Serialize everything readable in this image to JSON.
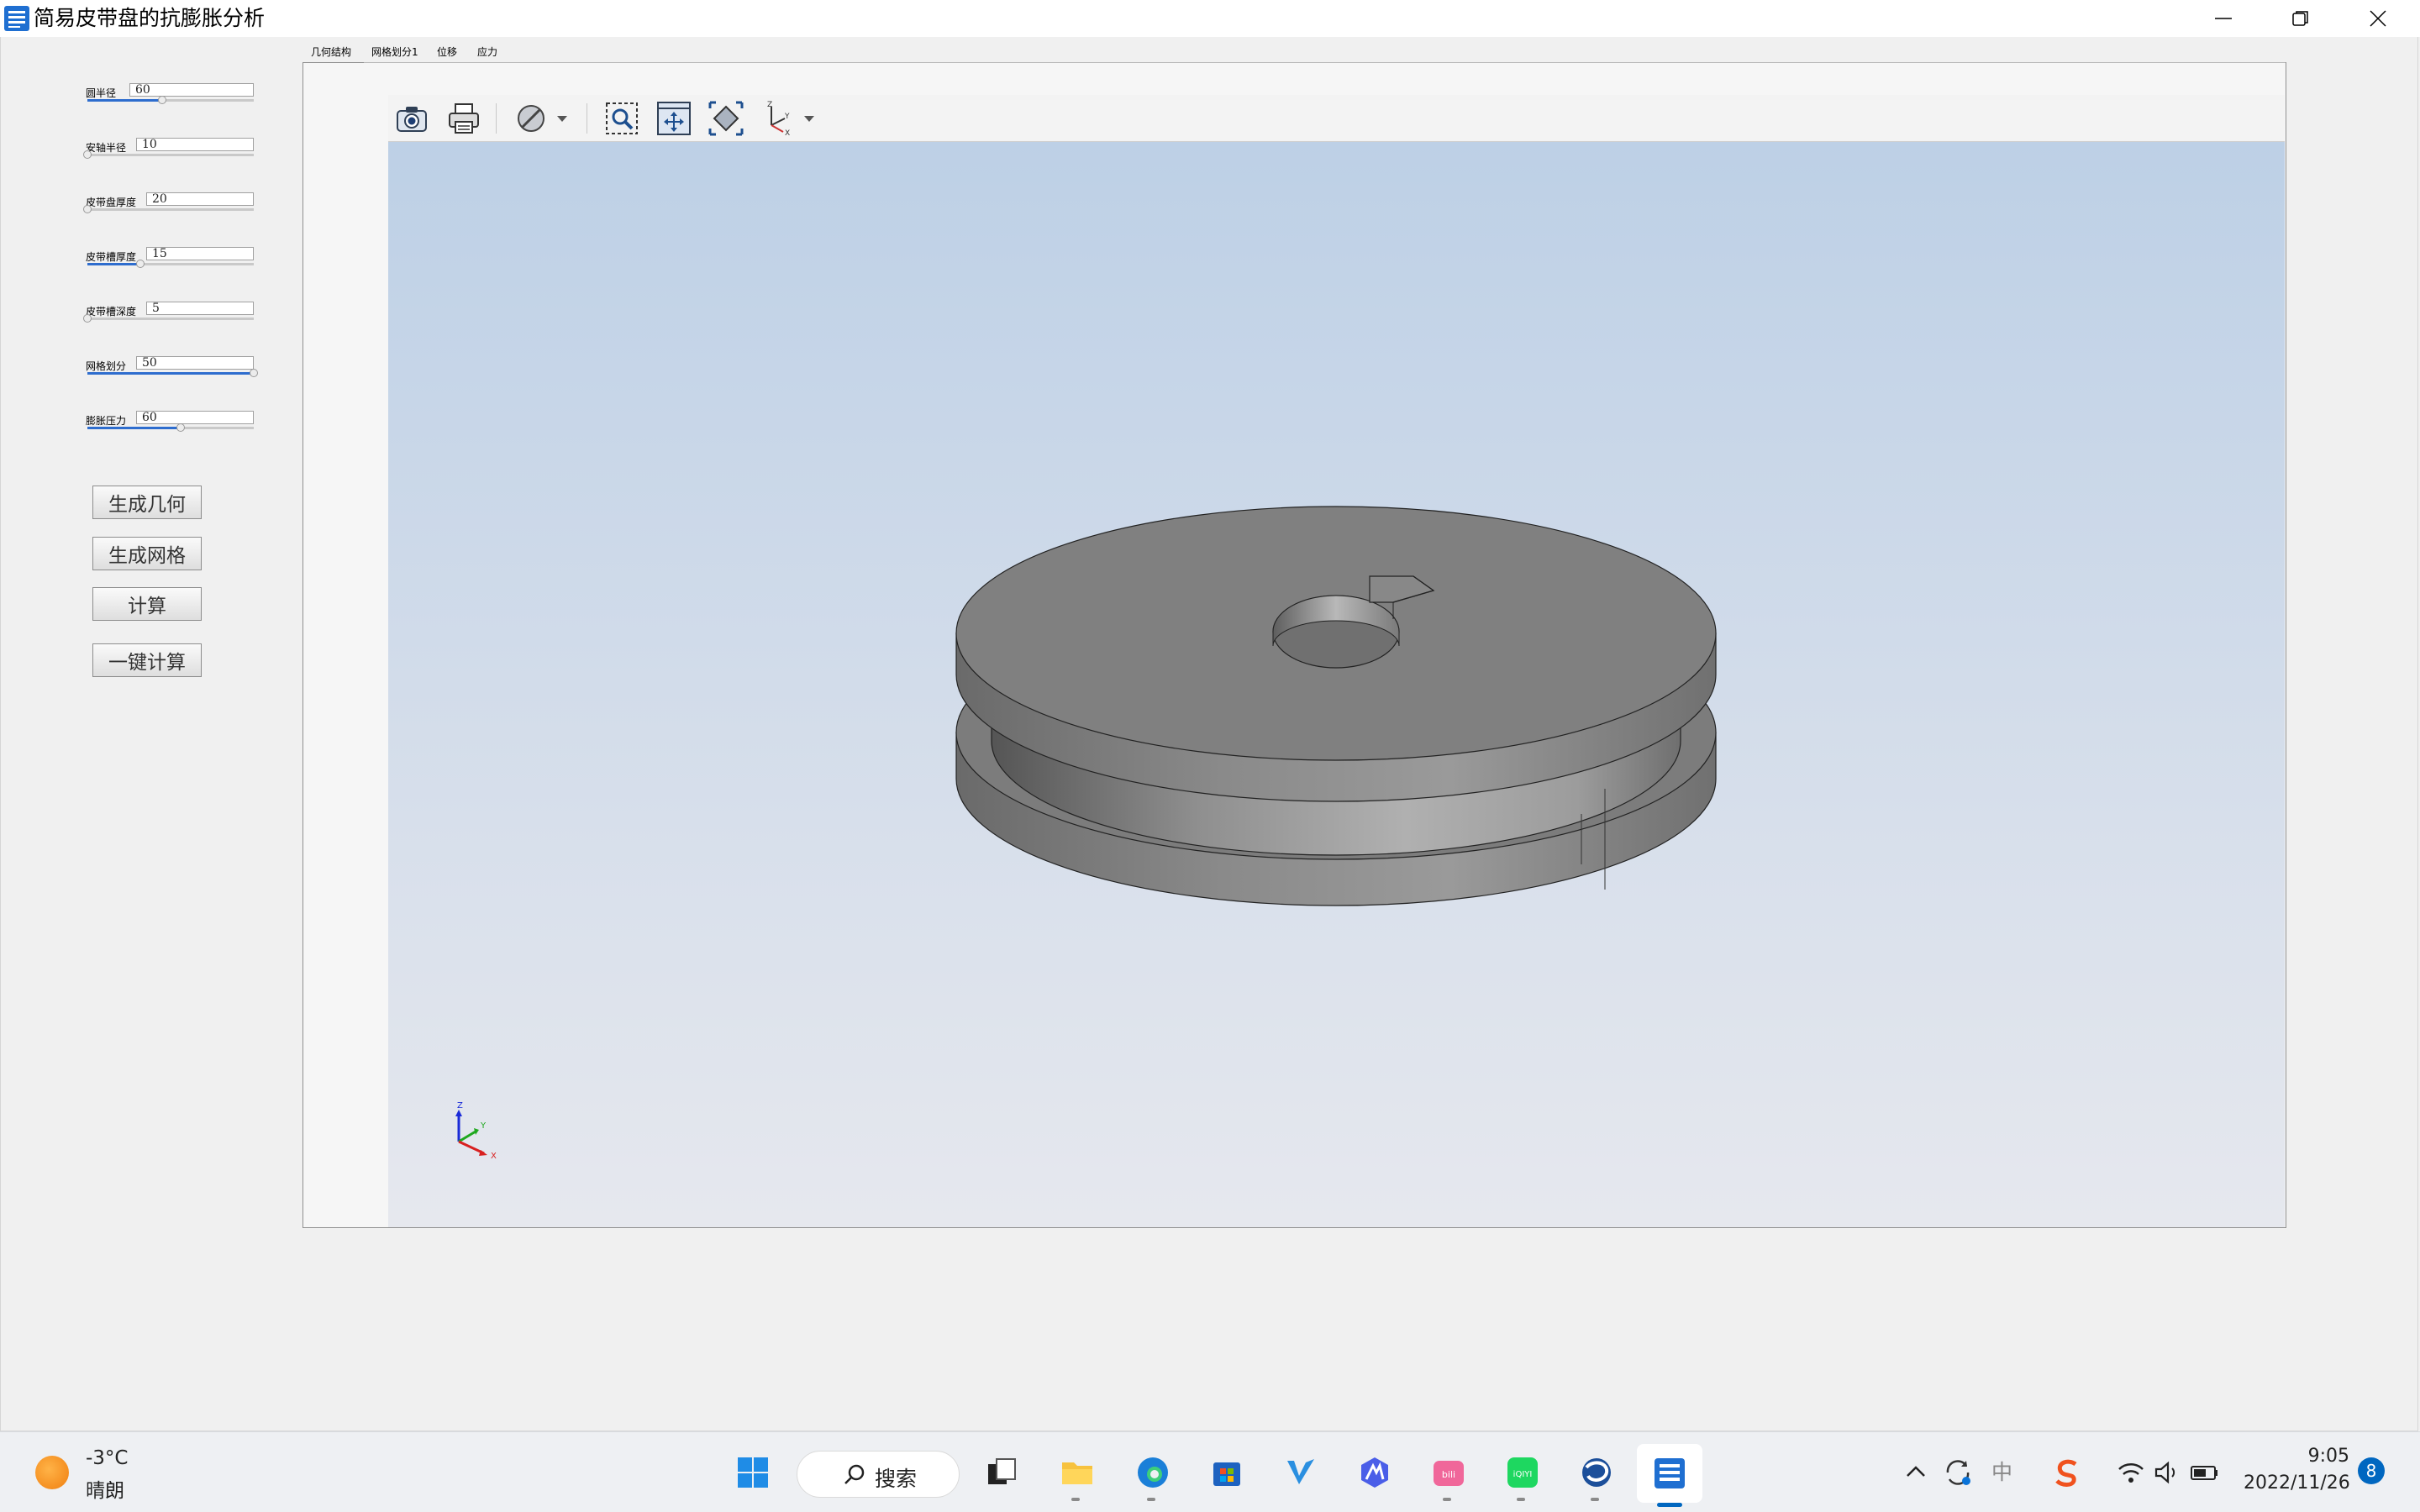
{
  "window": {
    "title": "简易皮带盘的抗膨胀分析"
  },
  "params": [
    {
      "label": "圆半径",
      "value": "60",
      "level": 0.45
    },
    {
      "label": "安轴半径",
      "value": "10",
      "level": 0.0
    },
    {
      "label": "皮带盘厚度",
      "value": "20",
      "level": 0.0
    },
    {
      "label": "皮带槽厚度",
      "value": "15",
      "level": 0.32
    },
    {
      "label": "皮带槽深度",
      "value": "5",
      "level": 0.0
    },
    {
      "label": "网格划分",
      "value": "50",
      "level": 1.0
    },
    {
      "label": "膨胀压力",
      "value": "60",
      "level": 0.56
    }
  ],
  "actions": {
    "gen_geometry": "生成几何",
    "gen_mesh": "生成网格",
    "compute": "计算",
    "one_click": "一键计算"
  },
  "tabs": [
    "几何结构",
    "网格划分1",
    "位移",
    "应力"
  ],
  "toolbar_icons": [
    "camera-icon",
    "print-icon",
    "display-mode-icon",
    "dropdown-arrow-icon",
    "zoom-box-icon",
    "pan-icon",
    "fit-all-icon",
    "axis-view-icon",
    "dropdown-arrow-icon"
  ],
  "triad": {
    "x": "X",
    "y": "Y",
    "z": "Z"
  },
  "colors": {
    "accent": "#2e6dce",
    "model_gray": "#808080",
    "taskbar_accent": "#0067c0"
  },
  "taskbar": {
    "weather_temp": "-3°C",
    "weather_desc": "晴朗",
    "search_label": "搜索",
    "ime": "中",
    "time": "9:05",
    "date": "2022/11/26",
    "notifications": "8",
    "apps": [
      "windows-start-icon",
      "search",
      "task-view-icon",
      "file-explorer-icon",
      "edge-icon",
      "store-icon",
      "vpn-icon",
      "arc-icon",
      "bilibili-icon",
      "iqiyi-icon",
      "browser-icon",
      "active-app-icon"
    ]
  }
}
